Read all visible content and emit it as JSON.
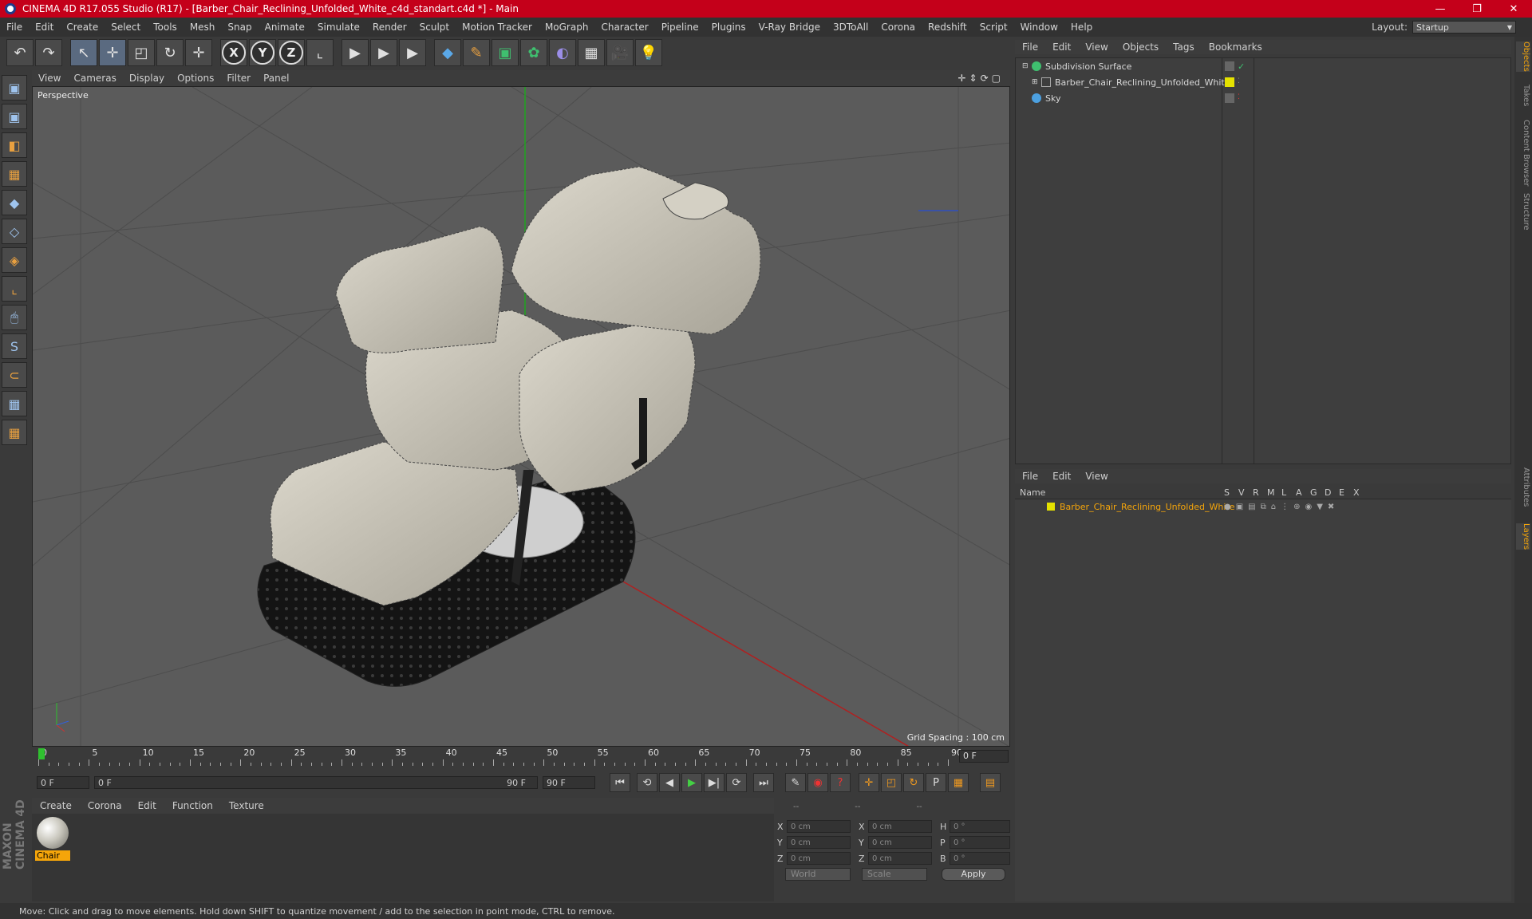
{
  "window": {
    "title": "CINEMA 4D R17.055 Studio (R17) - [Barber_Chair_Reclining_Unfolded_White_c4d_standart.c4d *] - Main",
    "controls": [
      "—",
      "❐",
      "✕"
    ]
  },
  "menubar": {
    "items": [
      "File",
      "Edit",
      "Create",
      "Select",
      "Tools",
      "Mesh",
      "Snap",
      "Animate",
      "Simulate",
      "Render",
      "Sculpt",
      "Motion Tracker",
      "MoGraph",
      "Character",
      "Pipeline",
      "Plugins",
      "V-Ray Bridge",
      "3DToAll",
      "Corona",
      "Redshift",
      "Script",
      "Window",
      "Help"
    ],
    "layout_label": "Layout:",
    "layout_value": "Startup"
  },
  "toolbar": {
    "undo": "↶",
    "redo": "↷",
    "select": "↖",
    "move": "✛",
    "scale": "◰",
    "rotate": "↻",
    "multi": "✛",
    "axis_x": "X",
    "axis_y": "Y",
    "axis_z": "Z",
    "coord": "⌞",
    "render_view": "▶",
    "render_pv": "▶",
    "render_settings": "▶",
    "cube": "◆",
    "pen": "✎",
    "subdivide": "▣",
    "array": "✿",
    "deform": "◐",
    "floor": "▦",
    "camera": "🎥",
    "light": "💡"
  },
  "lefttools": [
    "▣",
    "◧",
    "▦",
    "◆",
    "◇",
    "◈",
    "⌞",
    "🖱",
    "S",
    "⊂",
    "▦",
    "▦"
  ],
  "maxon": "MAXON CINEMA 4D",
  "viewport": {
    "menu": [
      "View",
      "Cameras",
      "Display",
      "Options",
      "Filter",
      "Panel"
    ],
    "nav_icons": "✛⇕⟳▢",
    "camera": "Perspective",
    "grid_spacing": "Grid Spacing : 100 cm"
  },
  "timeline": {
    "ticks": [
      "0",
      "5",
      "10",
      "15",
      "20",
      "25",
      "30",
      "35",
      "40",
      "45",
      "50",
      "55",
      "60",
      "65",
      "70",
      "75",
      "80",
      "85",
      "90"
    ],
    "current_frame": "0 F"
  },
  "transport": {
    "start": "0 F",
    "slider_start": "0 F",
    "slider_end": "90 F",
    "end": "90 F",
    "buttons": [
      "⏮",
      "⟲",
      "◀",
      "▶",
      "▶|",
      "⟳",
      "⏭"
    ],
    "key_buttons": [
      "✎",
      "◉",
      "?",
      "✛",
      "◰",
      "↻",
      "P",
      "▦",
      "▤"
    ]
  },
  "material_manager": {
    "menu": [
      "Create",
      "Corona",
      "Edit",
      "Function",
      "Texture"
    ],
    "material_name": "Chair"
  },
  "coordinates": {
    "header": [
      "--",
      "--",
      "--"
    ],
    "rows": [
      {
        "axis1": "X",
        "v1": "0 cm",
        "axis2": "X",
        "v2": "0 cm",
        "axis3": "H",
        "v3": "0 °"
      },
      {
        "axis1": "Y",
        "v1": "0 cm",
        "axis2": "Y",
        "v2": "0 cm",
        "axis3": "P",
        "v3": "0 °"
      },
      {
        "axis1": "Z",
        "v1": "0 cm",
        "axis2": "Z",
        "v2": "0 cm",
        "axis3": "B",
        "v3": "0 °"
      }
    ],
    "mode": "World",
    "size_mode": "Scale",
    "apply": "Apply"
  },
  "object_manager": {
    "menu": [
      "File",
      "Edit",
      "View",
      "Objects",
      "Tags",
      "Bookmarks"
    ],
    "objects": [
      {
        "name": "Subdivision Surface"
      },
      {
        "name": "Barber_Chair_Reclining_Unfolded_White"
      },
      {
        "name": "Sky"
      }
    ]
  },
  "layer_manager": {
    "menu": [
      "File",
      "Edit",
      "View"
    ],
    "columns": [
      "Name",
      "S",
      "V",
      "R",
      "M",
      "L",
      "A",
      "G",
      "D",
      "E",
      "X"
    ],
    "layers": [
      {
        "name": "Barber_Chair_Reclining_Unfolded_White"
      }
    ]
  },
  "right_tabs": [
    "Objects",
    "Takes",
    "Content Browser",
    "Structure",
    "Attributes",
    "Layers"
  ],
  "status": "Move: Click and drag to move elements. Hold down SHIFT to quantize movement / add to the selection in point mode, CTRL to remove."
}
